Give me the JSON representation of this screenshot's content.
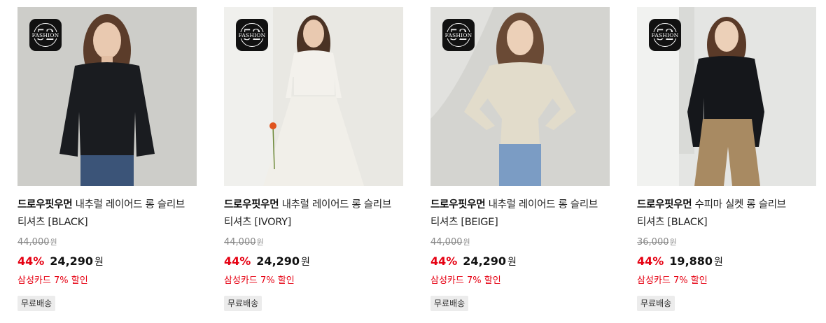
{
  "logo": {
    "text": "FASHION",
    "number": "52"
  },
  "products": [
    {
      "brand": "드로우핏우먼",
      "name": "내추럴 레이어드 롱 슬리브 티셔츠 [BLACK]",
      "original_price": "44,000",
      "original_unit": "원",
      "discount": "44%",
      "price": "24,290",
      "price_unit": "원",
      "promo": "삼성카드 7% 할인",
      "shipping": "무료배송",
      "colors": {
        "bg": "#c9c9c5",
        "top": "#1a1c20",
        "bottom": "#3b5478",
        "hair": "#5b3c2a"
      }
    },
    {
      "brand": "드로우핏우먼",
      "name": "내추럴 레이어드 롱 슬리브 티셔츠 [IVORY]",
      "original_price": "44,000",
      "original_unit": "원",
      "discount": "44%",
      "price": "24,290",
      "price_unit": "원",
      "promo": "삼성카드 7% 할인",
      "shipping": "무료배송",
      "colors": {
        "bg": "#e9e8e3",
        "top": "#f3f1ec",
        "bottom": "#f1efe9",
        "hair": "#4a3224"
      }
    },
    {
      "brand": "드로우핏우먼",
      "name": "내추럴 레이어드 롱 슬리브 티셔츠 [BEIGE]",
      "original_price": "44,000",
      "original_unit": "원",
      "discount": "44%",
      "price": "24,290",
      "price_unit": "원",
      "promo": "삼성카드 7% 할인",
      "shipping": "무료배송",
      "colors": {
        "bg": "#d4d4d0",
        "top": "#e2dccb",
        "bottom": "#7b9cc4",
        "hair": "#6a4a35"
      }
    },
    {
      "brand": "드로우핏우먼",
      "name": "수피마 실켓 롱 슬리브 티셔츠 [BLACK]",
      "original_price": "36,000",
      "original_unit": "원",
      "discount": "44%",
      "price": "19,880",
      "price_unit": "원",
      "promo": "삼성카드 7% 할인",
      "shipping": "무료배송",
      "colors": {
        "bg": "#e4e5e3",
        "top": "#15171b",
        "bottom": "#a88a62",
        "hair": "#5a3a28"
      }
    }
  ]
}
